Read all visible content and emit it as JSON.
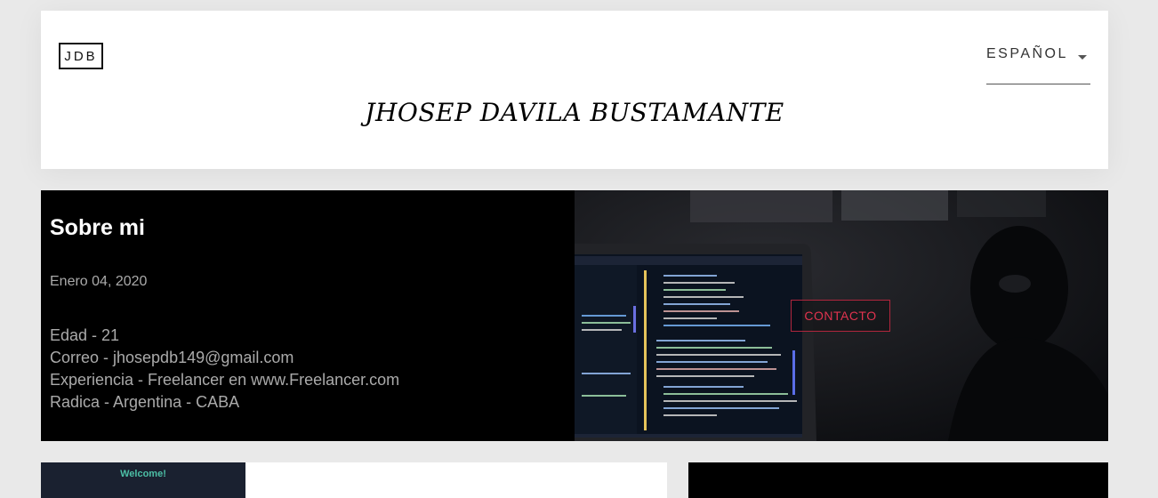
{
  "header": {
    "logo": "JDB",
    "language": "ESPAÑOL",
    "title": "JHOSEP DAVILA BUSTAMANTE"
  },
  "about": {
    "title": "Sobre mi",
    "date": "Enero 04, 2020",
    "info": [
      "Edad - 21",
      "Correo - jhosepdb149@gmail.com",
      "Experiencia - Freelancer en www.Freelancer.com",
      "Radica - Argentina - CABA"
    ],
    "contact_label": "CONTACTO"
  },
  "cards": {
    "welcome": "Welcome!"
  },
  "colors": {
    "background": "#e9e9e9",
    "accent": "#e1334f",
    "welcome_text": "#4cbfa6"
  }
}
